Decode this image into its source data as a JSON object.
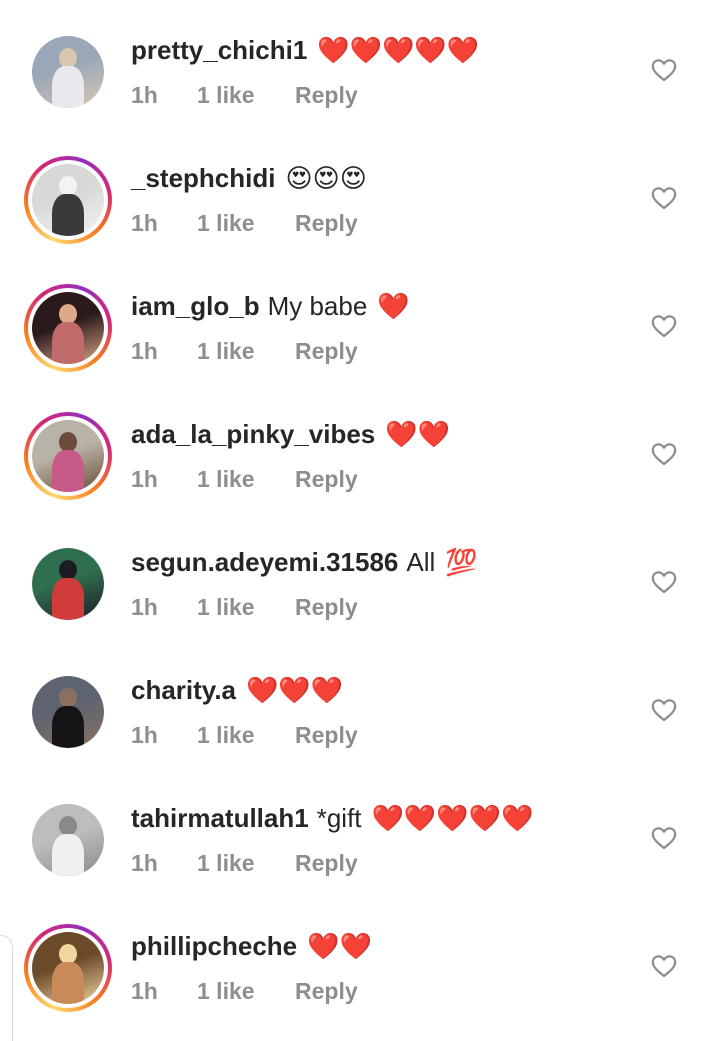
{
  "comments": [
    {
      "username": "pretty_chichi1",
      "text": "",
      "emoji": "❤️❤️❤️❤️❤️",
      "time": "1h",
      "likes": "1 like",
      "reply": "Reply",
      "story_ring": false,
      "avatar_colors": [
        "#9aa7b8",
        "#e8e8ee",
        "#d9c7b0"
      ]
    },
    {
      "username": "_stephchidi",
      "text": "",
      "emoji": "😍😍😍",
      "time": "1h",
      "likes": "1 like",
      "reply": "Reply",
      "story_ring": true,
      "avatar_colors": [
        "#d8d8d8",
        "#3a3a3a",
        "#f3f3f3"
      ]
    },
    {
      "username": "iam_glo_b",
      "text": "My babe",
      "emoji": "❤️",
      "time": "1h",
      "likes": "1 like",
      "reply": "Reply",
      "story_ring": true,
      "avatar_colors": [
        "#2a1a1c",
        "#c06a6a",
        "#e0a88a"
      ]
    },
    {
      "username": "ada_la_pinky_vibes",
      "text": "",
      "emoji": "❤️❤️",
      "time": "1h",
      "likes": "1 like",
      "reply": "Reply",
      "story_ring": true,
      "avatar_colors": [
        "#b9b2a6",
        "#c85a8a",
        "#6b4b3a"
      ]
    },
    {
      "username": "segun.adeyemi.31586",
      "text": "All",
      "emoji": "💯",
      "time": "1h",
      "likes": "1 like",
      "reply": "Reply",
      "story_ring": false,
      "avatar_colors": [
        "#2f6f4f",
        "#d13b3b",
        "#1c1c24"
      ]
    },
    {
      "username": "charity.a",
      "text": "",
      "emoji": "❤️❤️❤️",
      "time": "1h",
      "likes": "1 like",
      "reply": "Reply",
      "story_ring": false,
      "avatar_colors": [
        "#5d6470",
        "#151515",
        "#8a7060"
      ]
    },
    {
      "username": "tahirmatullah1",
      "text": "*gift",
      "emoji": "❤️❤️❤️❤️❤️",
      "time": "1h",
      "likes": "1 like",
      "reply": "Reply",
      "story_ring": false,
      "avatar_colors": [
        "#bdbdbd",
        "#f0f0f0",
        "#8a8a8a"
      ]
    },
    {
      "username": "phillipcheche",
      "text": "",
      "emoji": "❤️❤️",
      "time": "1h",
      "likes": "1 like",
      "reply": "Reply",
      "story_ring": true,
      "avatar_colors": [
        "#6b4a2a",
        "#c98a5a",
        "#f2d6a0"
      ]
    }
  ],
  "icons": {
    "like": "heart-outline-icon"
  },
  "colors": {
    "text": "#262626",
    "meta": "#8e8e8e",
    "heart_emoji": "#e0151f"
  }
}
